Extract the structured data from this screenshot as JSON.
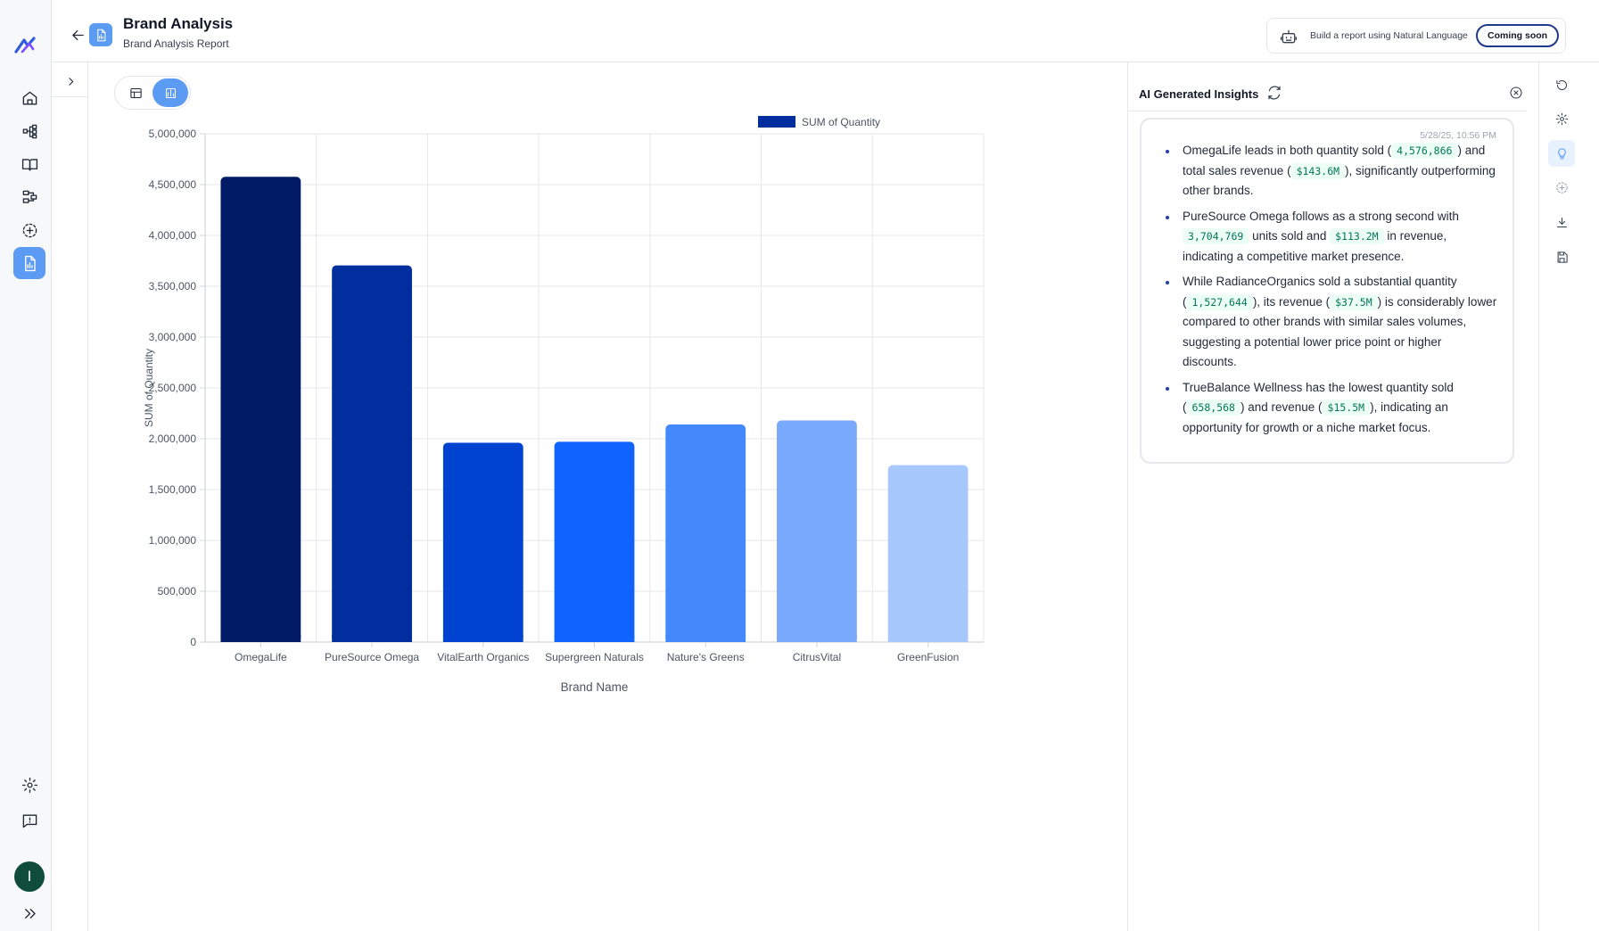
{
  "header": {
    "title": "Brand Analysis",
    "subtitle": "Brand Analysis Report",
    "nl_prompt": "Build a report using Natural Language",
    "coming_soon_label": "Coming soon"
  },
  "user": {
    "avatar_initial": "I"
  },
  "chart_data": {
    "type": "bar",
    "title": "",
    "xlabel": "Brand Name",
    "ylabel": "SUM of Quantity",
    "legend": "top",
    "grid": true,
    "ylim": [
      0,
      5000000
    ],
    "yticks": [
      "0",
      "500,000",
      "1,000,000",
      "1,500,000",
      "2,000,000",
      "2,500,000",
      "3,000,000",
      "3,500,000",
      "4,000,000",
      "4,500,000",
      "5,000,000"
    ],
    "categories": [
      "OmegaLife",
      "PureSource Omega",
      "VitalEarth Organics",
      "Supergreen Naturals",
      "Nature's Greens",
      "CitrusVital",
      "GreenFusion"
    ],
    "series": [
      {
        "name": "SUM of Quantity",
        "values": [
          4576866,
          3704769,
          1960000,
          1970000,
          2140000,
          2180000,
          1740000
        ]
      }
    ],
    "colors": [
      "#001a66",
      "#002e9e",
      "#0043d1",
      "#1063fd",
      "#4389fb",
      "#78a9fb",
      "#a6c8fd"
    ],
    "legend_color": "#002e9e"
  },
  "insights": {
    "title": "AI Generated Insights",
    "timestamp": "5/28/25, 10:56 PM",
    "items": [
      {
        "p0": "OmegaLife leads in both quantity sold (",
        "m0": "4,576,866",
        "p1": ") and total sales revenue (",
        "m1": "$143.6M",
        "p2": "), significantly outperforming other brands."
      },
      {
        "p0": "PureSource Omega follows as a strong second with ",
        "m0": "3,704,769",
        "p1": " units sold and ",
        "m1": "$113.2M",
        "p2": " in revenue, indicating a competitive market presence."
      },
      {
        "p0": "While RadianceOrganics sold a substantial quantity (",
        "m0": "1,527,644",
        "p1": "), its revenue (",
        "m1": "$37.5M",
        "p2": ") is considerably lower compared to other brands with similar sales volumes, suggesting a potential lower price point or higher discounts."
      },
      {
        "p0": "TrueBalance Wellness has the lowest quantity sold (",
        "m0": "658,568",
        "p1": ") and revenue (",
        "m1": "$15.5M",
        "p2": "), indicating an opportunity for growth or a niche market focus."
      }
    ]
  },
  "accent_color": "#5b9bf4"
}
